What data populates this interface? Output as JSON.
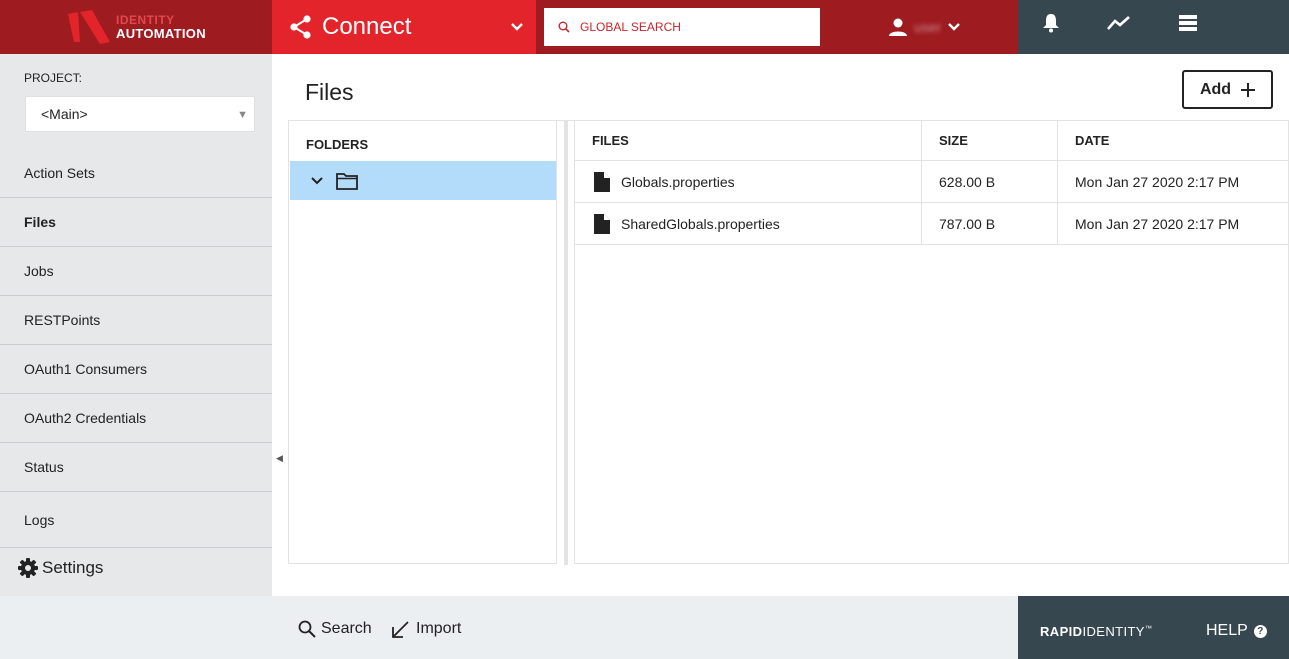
{
  "brand": {
    "logo_line1": "IDENTITY",
    "logo_line2": "AUTOMATION"
  },
  "header": {
    "module_title": "Connect",
    "search_placeholder": "GLOBAL SEARCH",
    "user_name": "user",
    "colors": {
      "primary_dark": "#9e1b20",
      "primary": "#e3242b",
      "slate": "#37474f"
    }
  },
  "sidebar": {
    "project_label": "PROJECT:",
    "project_value": "<Main>",
    "items": [
      {
        "label": "Action Sets"
      },
      {
        "label": "Files"
      },
      {
        "label": "Jobs"
      },
      {
        "label": "RESTPoints"
      },
      {
        "label": "OAuth1 Consumers"
      },
      {
        "label": "OAuth2 Credentials"
      },
      {
        "label": "Status"
      },
      {
        "label": "Logs"
      }
    ],
    "settings_label": "Settings"
  },
  "main": {
    "title": "Files",
    "add_label": "Add",
    "folders": {
      "header": "FOLDERS"
    },
    "files": {
      "columns": [
        "FILES",
        "SIZE",
        "DATE"
      ],
      "rows": [
        {
          "name": "Globals.properties",
          "size": "628.00 B",
          "date": "Mon Jan 27 2020 2:17 PM"
        },
        {
          "name": "SharedGlobals.properties",
          "size": "787.00 B",
          "date": "Mon Jan 27 2020 2:17 PM"
        }
      ]
    }
  },
  "footer": {
    "search_label": "Search",
    "import_label": "Import",
    "brand_bold": "RAPID",
    "brand_light": "IDENTITY",
    "brand_tm": "™",
    "help_label": "HELP",
    "help_mark": "?"
  }
}
